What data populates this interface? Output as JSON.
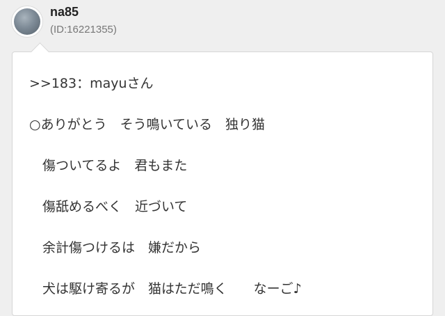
{
  "post": {
    "user_name": "na85",
    "user_id": "(ID:16221355)",
    "avatar_icon": "user-avatar-icon"
  },
  "message": {
    "reply_ref": ">>183",
    "reply_to": "：mayuさん",
    "lines": [
      "○ありがとう　そう鳴いている　独り猫",
      "　傷ついてるよ　君もまた",
      "　傷舐めるべく　近づいて",
      "　余計傷つけるは　嫌だから",
      "　犬は駆け寄るが　猫はただ鳴く　　なーご♪"
    ]
  }
}
